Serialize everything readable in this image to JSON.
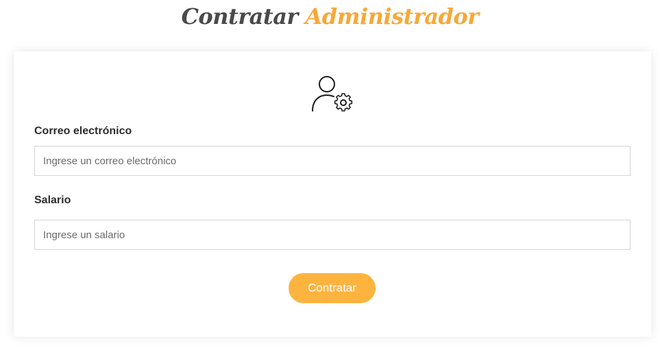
{
  "header": {
    "title_part1": "Contratar",
    "title_part2": "Administrador"
  },
  "form": {
    "icon": "user-gear-icon",
    "email": {
      "label": "Correo electrónico",
      "placeholder": "Ingrese un correo electrónico",
      "value": ""
    },
    "salary": {
      "label": "Salario",
      "placeholder": "Ingrese un salario",
      "value": ""
    },
    "submit_label": "Contratar"
  },
  "colors": {
    "accent": "#fdb43f",
    "title_accent": "#f7a838",
    "title_dark": "#4a4a4a",
    "label_text": "#2d2d2d",
    "input_border": "#d4d4d4"
  }
}
